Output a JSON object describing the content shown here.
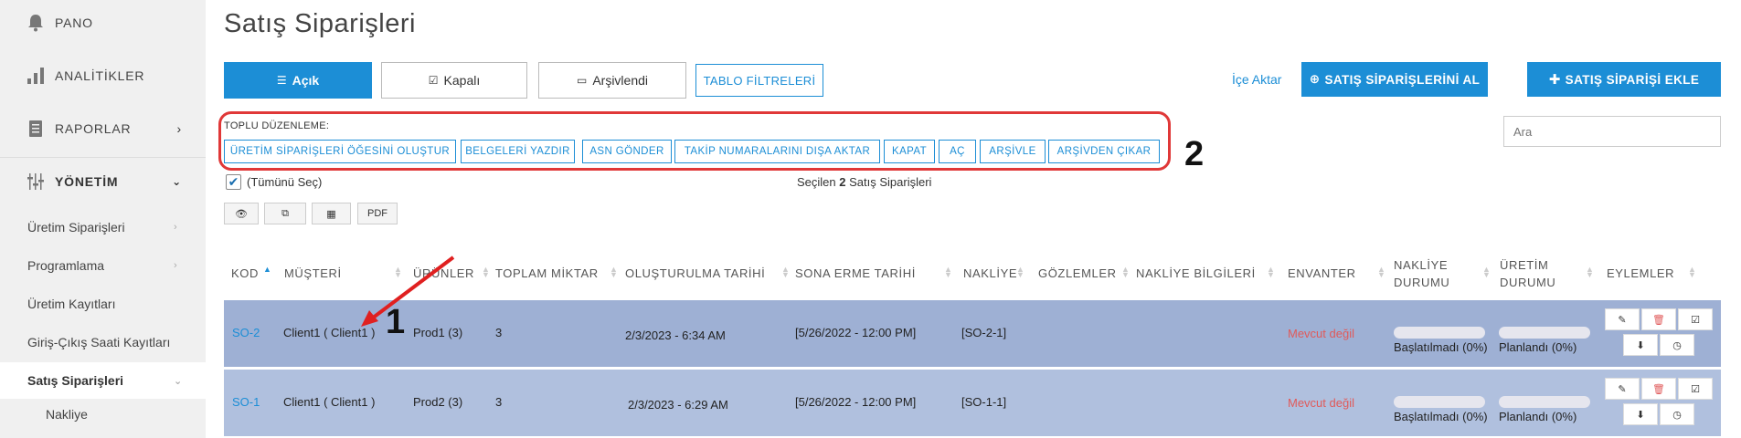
{
  "sidebar": {
    "pano": "PANO",
    "analitikler": "ANALİTİKLER",
    "raporlar": "RAPORLAR",
    "yonetim": "YÖNETİM",
    "items": [
      {
        "label": "Üretim Siparişleri"
      },
      {
        "label": "Programlama"
      },
      {
        "label": "Üretim Kayıtları"
      },
      {
        "label": "Giriş-Çıkış Saati Kayıtları"
      },
      {
        "label": "Satış Siparişleri"
      }
    ],
    "sub_item": "Nakliye"
  },
  "header": {
    "title": "Satış Siparişleri",
    "tabs": [
      {
        "label": "Açık",
        "icon": "list-icon"
      },
      {
        "label": "Kapalı",
        "icon": "check-square-icon"
      },
      {
        "label": "Arşivlendi",
        "icon": "inbox-icon"
      }
    ],
    "filter_label": "TABLO FİLTRELERİ",
    "import_label": "İçe Aktar",
    "fetch_label": "SATIŞ SİPARİŞLERİNİ AL",
    "add_label": "SATIŞ SİPARİŞİ EKLE"
  },
  "bulk": {
    "label": "TOPLU DÜZENLEME:",
    "buttons": [
      "ÜRETİM SİPARİŞLERİ ÖĞESİNİ OLUŞTUR",
      "BELGELERİ YAZDIR",
      "ASN GÖNDER",
      "TAKİP NUMARALARINI DIŞA AKTAR",
      "KAPAT",
      "AÇ",
      "ARŞİVLE",
      "ARŞİVDEN ÇIKAR"
    ]
  },
  "callouts": {
    "one": "1",
    "two": "2"
  },
  "search": {
    "placeholder": "Ara"
  },
  "selection": {
    "select_all": "(Tümünü Seç)",
    "prefix": "Seçilen",
    "count": "2",
    "suffix": "Satış Siparişleri"
  },
  "export": {
    "pdf": "PDF"
  },
  "table": {
    "headers": {
      "kod": "KOD",
      "musteri": "MÜŞTERİ",
      "urunler": "ÜRÜNLER",
      "toplam": "TOPLAM MİKTAR",
      "olusturulma": "OLUŞTURULMA TARİHİ",
      "sona_erme": "SONA ERME TARİHİ",
      "nakliye": "NAKLİYE",
      "gozlemler": "GÖZLEMLER",
      "nakliye_bilgileri": "NAKLİYE BİLGİLERİ",
      "envanter": "ENVANTER",
      "nakliye_durumu_1": "NAKLİYE",
      "nakliye_durumu_2": "DURUMU",
      "uretim_durumu_1": "ÜRETİM",
      "uretim_durumu_2": "DURUMU",
      "eylemler": "EYLEMLER"
    },
    "rows": [
      {
        "kod": "SO-2",
        "musteri": "Client1 ( Client1 )",
        "urunler": "Prod1 (3)",
        "toplam": "3",
        "olusturulma": "2/3/2023 - 6:34 AM",
        "sona_erme": "[5/26/2022 - 12:00 PM]",
        "nakliye": "[SO-2-1]",
        "envanter": "Mevcut değil",
        "nakliye_durumu": "Başlatılmadı (0%)",
        "nakliye_progress": 0,
        "uretim_durumu": "Planlandı (0%)",
        "uretim_progress": 0
      },
      {
        "kod": "SO-1",
        "musteri": "Client1 ( Client1 )",
        "urunler": "Prod2 (3)",
        "toplam": "3",
        "olusturulma": "2/3/2023 - 6:29 AM",
        "sona_erme": "[5/26/2022 - 12:00 PM]",
        "nakliye": "[SO-1-1]",
        "envanter": "Mevcut değil",
        "nakliye_durumu": "Başlatılmadı (0%)",
        "nakliye_progress": 0,
        "uretim_durumu": "Planlandı (0%)",
        "uretim_progress": 0
      }
    ]
  },
  "colors": {
    "accent": "#1c8ed6",
    "highlight": "#e03838",
    "row_selected": "#9eb0d4",
    "danger": "#e05a5a"
  }
}
